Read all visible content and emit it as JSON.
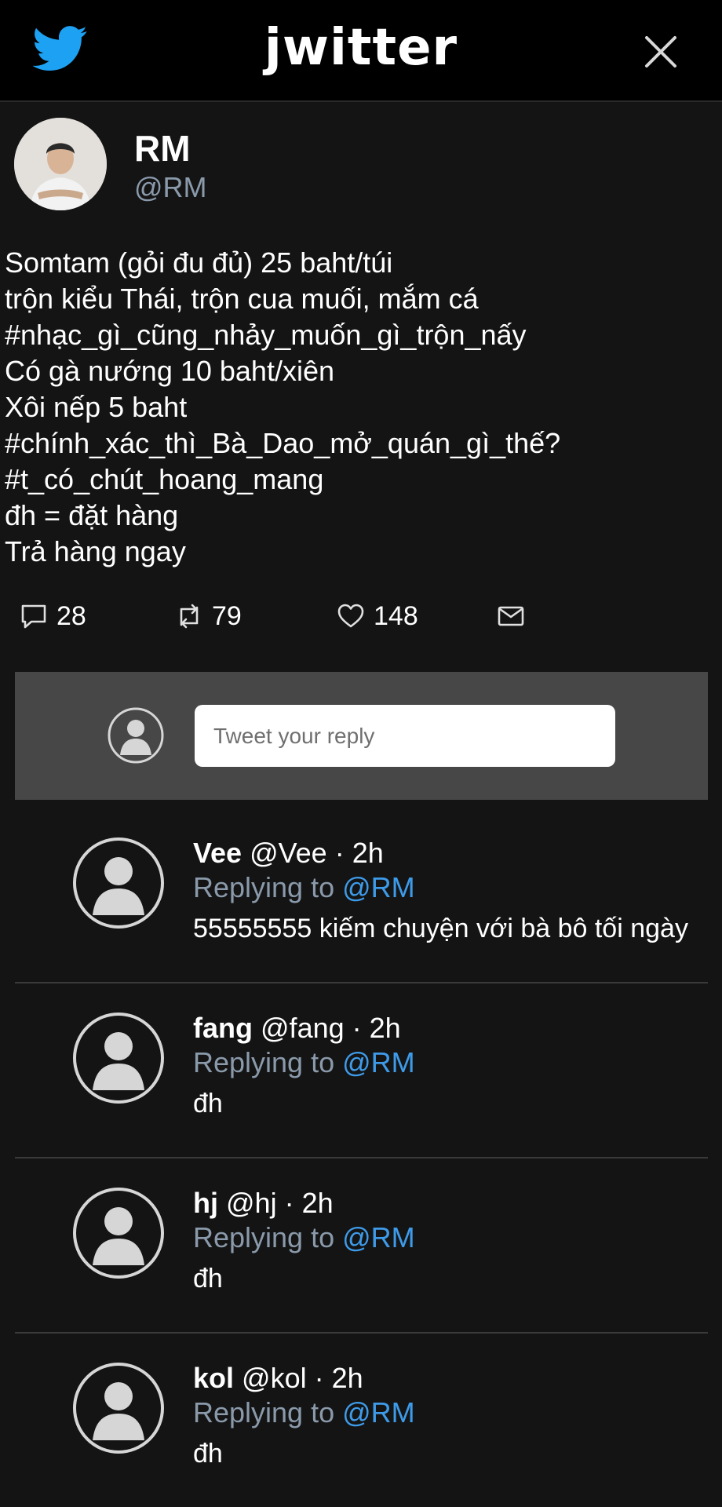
{
  "header": {
    "logo_text": "jwitter",
    "brand_color": "#1da1f2",
    "bird_icon": "twitter-bird-icon",
    "close_icon": "close-icon"
  },
  "tweet": {
    "author_name": "RM",
    "author_handle": "@RM",
    "lines": [
      "Somtam (gỏi đu đủ) 25 baht/túi",
      "trộn kiểu Thái, trộn cua muối, mắm cá",
      "#nhạc_gì_cũng_nhảy_muốn_gì_trộn_nấy",
      "Có gà nướng 10 baht/xiên",
      "Xôi nếp 5 baht",
      "#chính_xác_thì_Bà_Dao_mở_quán_gì_thế?",
      "#t_có_chút_hoang_mang",
      "đh = đặt hàng",
      "Trả hàng ngay"
    ],
    "stats": {
      "replies": "28",
      "retweets": "79",
      "likes": "148"
    }
  },
  "reply_box": {
    "placeholder": "Tweet your reply"
  },
  "replies": [
    {
      "name": "Vee",
      "handle": "@Vee",
      "time": "· 2h",
      "replying_label": "Replying to",
      "mention": "@RM",
      "text": "55555555 kiếm chuyện với bà bô tối ngày"
    },
    {
      "name": "fang",
      "handle": "@fang",
      "time": "· 2h",
      "replying_label": "Replying to",
      "mention": "@RM",
      "text": "đh"
    },
    {
      "name": "hj",
      "handle": "@hj",
      "time": "· 2h",
      "replying_label": "Replying to",
      "mention": "@RM",
      "text": "đh"
    },
    {
      "name": "kol",
      "handle": "@kol",
      "time": "· 2h",
      "replying_label": "Replying to",
      "mention": "@RM",
      "text": "đh"
    }
  ]
}
